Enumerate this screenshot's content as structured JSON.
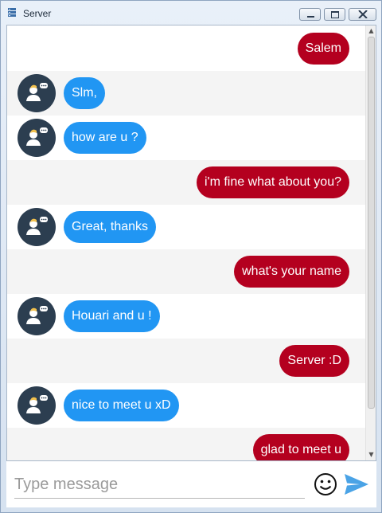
{
  "window": {
    "title": "Server"
  },
  "composer": {
    "placeholder": "Type message"
  },
  "messages": [
    {
      "side": "out",
      "text": "Salem"
    },
    {
      "side": "in",
      "text": "Slm,"
    },
    {
      "side": "in",
      "text": "how are u ?"
    },
    {
      "side": "out",
      "text": "i'm fine what about you?"
    },
    {
      "side": "in",
      "text": "Great, thanks"
    },
    {
      "side": "out",
      "text": "what's your name"
    },
    {
      "side": "in",
      "text": "Houari and u !"
    },
    {
      "side": "out",
      "text": "Server :D"
    },
    {
      "side": "in",
      "text": "nice to meet u xD"
    },
    {
      "side": "out",
      "text": "glad to meet u"
    }
  ],
  "colors": {
    "incoming": "#2196f3",
    "outgoing": "#b4001f",
    "avatar_bg": "#2c3e50",
    "send_icon": "#4aa3e6"
  },
  "icons": {
    "avatar": "user-chat-icon",
    "emoji": "smiley-icon",
    "send": "send-arrow-icon"
  }
}
